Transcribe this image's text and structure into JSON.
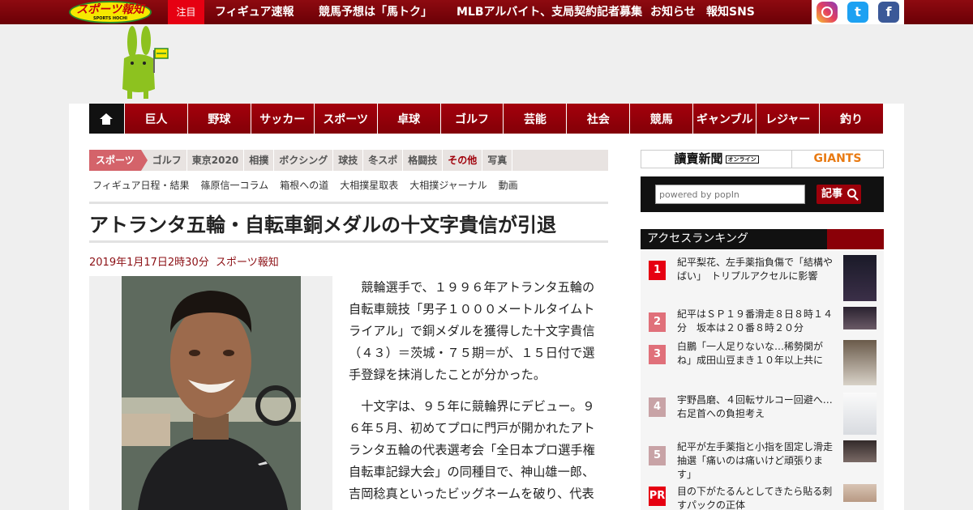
{
  "header": {
    "logo_text": "スポーツ報知",
    "logo_sub": "SPORTS HOCHI",
    "chumoku": "注目",
    "links": [
      "フィギュア速報",
      "競馬予想は「馬トク」",
      "MLBアルバイト、支局契約記者募集",
      "お知らせ",
      "報知SNS"
    ],
    "social": {
      "instagram": "instagram-icon",
      "twitter": "t",
      "facebook": "f"
    }
  },
  "nav": {
    "home_icon": "home-icon",
    "items": [
      "巨人",
      "野球",
      "サッカー",
      "スポーツ",
      "卓球",
      "ゴルフ",
      "芸能",
      "社会",
      "競馬",
      "ギャンブル",
      "レジャー",
      "釣り"
    ]
  },
  "subnav": {
    "active": "スポーツ",
    "items": [
      "ゴルフ",
      "東京2020",
      "相撲",
      "ボクシング",
      "球技",
      "冬スポ",
      "格闘技",
      "その他",
      "写真"
    ],
    "sub_items": [
      "フィギュア日程・結果",
      "篠原信一コラム",
      "箱根への道",
      "大相撲星取表",
      "大相撲ジャーナル",
      "動画"
    ]
  },
  "article": {
    "title": "アトランタ五輪・自転車銅メダルの十文字貴信が引退",
    "date": "2019年1月17日2時30分",
    "source": "スポーツ報知",
    "paragraphs": [
      "競輪選手で、１９９６年アトランタ五輪の自転車競技「男子１０００メートルタイムトライアル」で銅メダルを獲得した十文字貴信（４３）＝茨城・７５期＝が、１５日付で選手登録を抹消したことが分かった。",
      "十文字は、９５年に競輪界にデビュー。９６年５月、初めてプロに門戸が開かれたアトランタ五輪の代表選考会「全日本プロ選手権自転車記録大会」の同種目で、神山雄一郎、吉岡稔真といったビッグネームを破り、代表"
    ]
  },
  "sidebar": {
    "banner_left": "讀賣新聞",
    "banner_left_badge": "オンライン",
    "banner_right": "GIANTS",
    "search_placeholder": "powered by popIn",
    "search_button": "記事",
    "ranking_title": "アクセスランキング",
    "ranking": [
      {
        "num": "1",
        "text": "紀平梨花、左手薬指負傷で「結構やばい」　トリプルアクセルに影響",
        "color": "#e60012"
      },
      {
        "num": "2",
        "text": "紀平はＳＰ１９番滑走８日８時１４分　坂本は２０番８時２０分",
        "color": "#e0707a"
      },
      {
        "num": "3",
        "text": "白鵬「一人足りないな…稀勢関がね」成田山豆まき１０年以上共に",
        "color": "#e0707a"
      },
      {
        "num": "4",
        "text": "宇野昌磨、４回転サルコー回避へ…右足首への負担考え",
        "color": "#c8a3a6"
      },
      {
        "num": "5",
        "text": "紀平が左手薬指と小指を固定し滑走抽選「痛いのは痛いけど頑張ります」",
        "color": "#c8a3a6"
      },
      {
        "num": "PR",
        "text": "目の下がたるんとしてきたら貼る刺すパックの正体",
        "color": "#e60012"
      }
    ]
  }
}
